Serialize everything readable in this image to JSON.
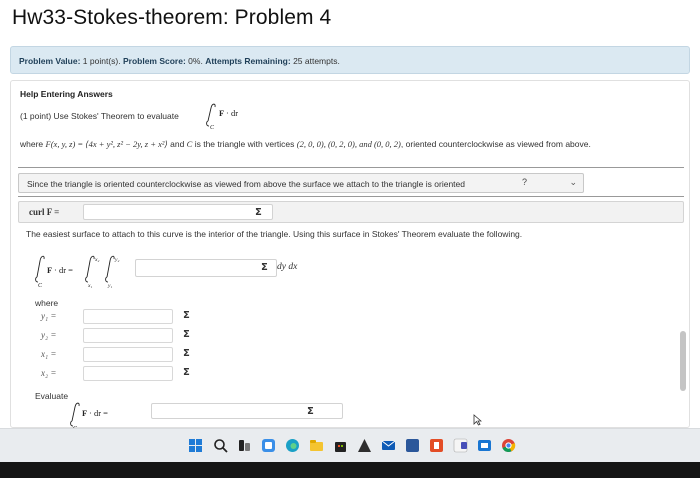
{
  "page_title": "Hw33-Stokes-theorem: Problem 4",
  "info_bar": {
    "value_label": "Problem Value:",
    "value": "1 point(s).",
    "score_label": "Problem Score:",
    "score": "0%.",
    "attempts_label": "Attempts Remaining:",
    "attempts": "25 attempts."
  },
  "problem": {
    "help_link": "Help Entering Answers",
    "intro": "(1 point) Use Stokes' Theorem to evaluate",
    "where_prefix": "where",
    "field": "F(x, y, z) = ⟨4x + y², z² − 2y, z + x²⟩",
    "where_middle": "and",
    "curve_symbol": "C",
    "where_rest": "is the triangle with vertices",
    "vertices": "(2, 0, 0), (0, 2, 0), and (0, 0, 2)",
    "where_suffix": "oriented counterclockwise as viewed from above.",
    "select_prompt": "Since the triangle is oriented counterclockwise as viewed from above the surface we attach to the triangle is oriented",
    "select_value": "?",
    "curl_label": "curl F =",
    "surface_text": "The easiest surface to attach to this curve is the interior of the triangle. Using this surface in Stokes' Theorem evaluate the following.",
    "differential": "dy dx",
    "where_label": "where",
    "bounds": [
      {
        "label": "y₁ ="
      },
      {
        "label": "y₂ ="
      },
      {
        "label": "x₁ ="
      },
      {
        "label": "x₂ ="
      }
    ],
    "evaluate_label": "Evaluate",
    "sigma": "Σ"
  },
  "icons": [
    "windows-start-icon",
    "search-icon",
    "task-view-icon",
    "widgets-icon",
    "edge-icon",
    "file-explorer-icon",
    "store-icon",
    "app-icon",
    "mail-icon",
    "word-icon",
    "app-icon-2",
    "teams-icon",
    "chrome-icon"
  ]
}
